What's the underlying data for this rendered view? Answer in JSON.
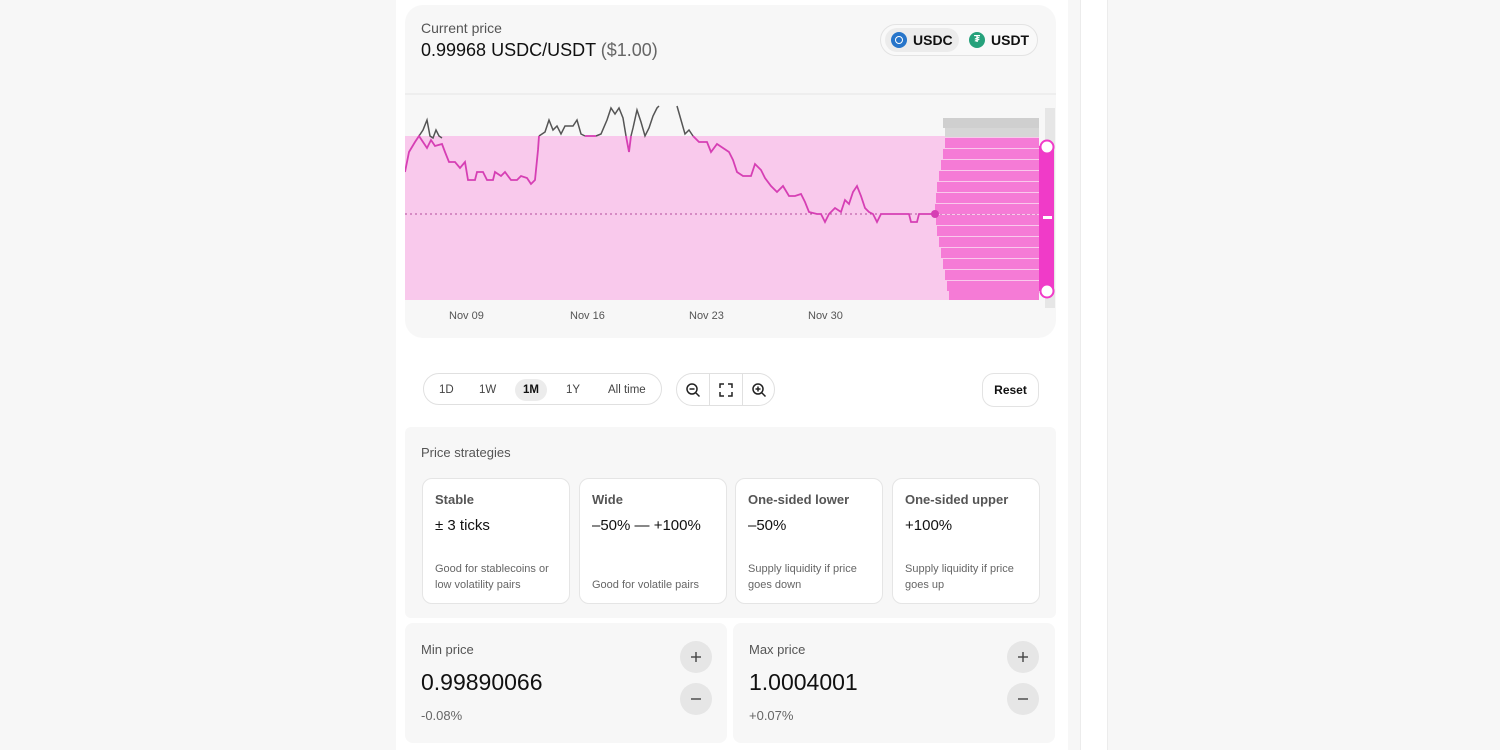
{
  "header": {
    "label": "Current price",
    "price": "0.99968 USDC/USDT",
    "usd": "($1.00)"
  },
  "tokens": [
    {
      "symbol": "USDC",
      "icon": "usdc-icon",
      "active": true
    },
    {
      "symbol": "USDT",
      "icon": "usdt-icon",
      "active": false
    }
  ],
  "chart": {
    "x_ticks": [
      "Nov 09",
      "Nov 16",
      "Nov 23",
      "Nov 30"
    ],
    "colors": {
      "range_fill": "#f9c9ec",
      "line_in_range": "#d63fb4",
      "line_out": "#555555",
      "accent": "#f03bc8"
    }
  },
  "time_ranges": {
    "d1": "1D",
    "w1": "1W",
    "m1": "1M",
    "y1": "1Y",
    "all": "All time",
    "selected": "1M"
  },
  "zoom": {
    "out_icon": "zoom-out-icon",
    "fit_icon": "fit-screen-icon",
    "in_icon": "zoom-in-icon"
  },
  "reset_label": "Reset",
  "strategies": {
    "title": "Price strategies",
    "items": [
      {
        "name": "Stable",
        "value": "± 3 ticks",
        "desc": "Good for stablecoins or low volatility pairs"
      },
      {
        "name": "Wide",
        "value": "–50% — +100%",
        "desc": "Good for volatile pairs"
      },
      {
        "name": "One-sided lower",
        "value": "–50%",
        "desc": "Supply liquidity if price goes down"
      },
      {
        "name": "One-sided upper",
        "value": "+100%",
        "desc": "Supply liquidity if price goes up"
      }
    ]
  },
  "min_price": {
    "label": "Min price",
    "value": "0.99890066",
    "pct": "-0.08%"
  },
  "max_price": {
    "label": "Max price",
    "value": "1.0004001",
    "pct": "+0.07%"
  }
}
